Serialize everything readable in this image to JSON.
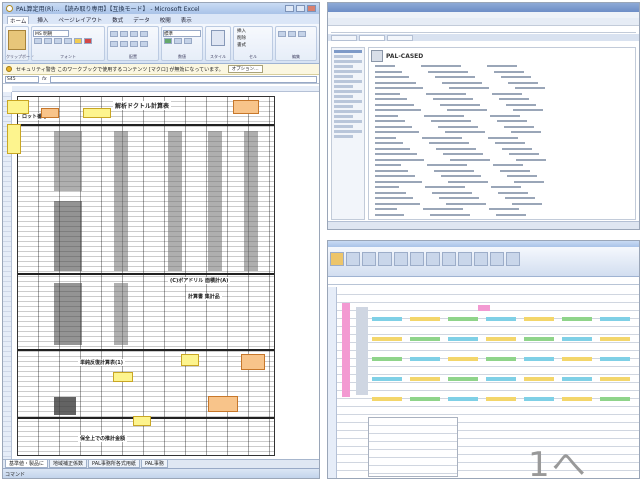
{
  "left_window": {
    "title": "PAL算定用(R)… 【読み取り専用】【互換モード】 - Microsoft Excel",
    "tabs": [
      "ホーム",
      "挿入",
      "ページレイアウト",
      "数式",
      "データ",
      "校閲",
      "表示"
    ],
    "ribbon": {
      "paste_label": "貼り付け",
      "clipboard_group": "クリップボード",
      "font_name": "MS 明朝",
      "font_group": "フォント",
      "align_group": "配置",
      "number_group": "数値",
      "style_group": "スタイル",
      "cells_group": "セル",
      "edit_group": "編集",
      "number_format": "標準",
      "insert_label": "挿入",
      "delete_label": "削除",
      "format_label": "書式"
    },
    "security_bar": {
      "text": "セキュリティ警告  このワークブックで使用するコンテンツ [マクロ] が無効になっています。",
      "button": "オプション…"
    },
    "name_box": "S45",
    "fx": "fx",
    "form": {
      "title": "解析ドクトル計算表",
      "lot_label": "ロット番号",
      "section_plain": "単純反復計算表(1)",
      "section_drill": "(C)ボアドリル  面積計(A)",
      "section_result": "計算書  集計品",
      "section_summary": "保全上での推計金額"
    },
    "sheet_tabs": [
      "基準値・製品に",
      "地域補正係数",
      "PAL事務所各式用紙",
      "PAL事務"
    ],
    "status": "コマンド"
  },
  "top_right_window": {
    "page_title": "PAL-CASED"
  },
  "bottom_right_window": {
    "overlay_text": "1へ"
  }
}
